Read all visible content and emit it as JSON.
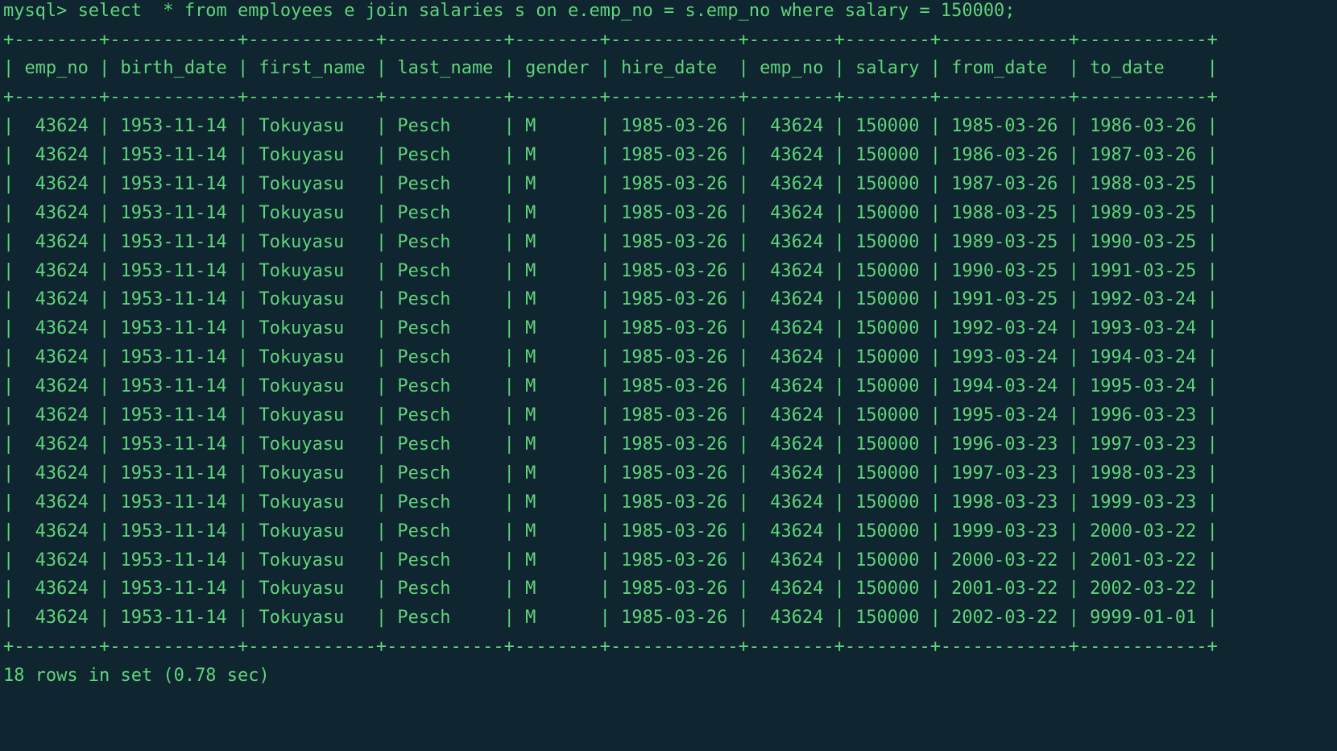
{
  "terminal": {
    "prompt_line": "mysql> select  * from employees e join salaries s on e.emp_no = s.emp_no where salary = 150000;",
    "status_line": "18 rows in set (0.78 sec)"
  },
  "table": {
    "columns": [
      "emp_no",
      "birth_date",
      "first_name",
      "last_name",
      "gender",
      "hire_date",
      "emp_no",
      "salary",
      "from_date",
      "to_date"
    ],
    "rows": [
      [
        "43624",
        "1953-11-14",
        "Tokuyasu",
        "Pesch",
        "M",
        "1985-03-26",
        "43624",
        "150000",
        "1985-03-26",
        "1986-03-26"
      ],
      [
        "43624",
        "1953-11-14",
        "Tokuyasu",
        "Pesch",
        "M",
        "1985-03-26",
        "43624",
        "150000",
        "1986-03-26",
        "1987-03-26"
      ],
      [
        "43624",
        "1953-11-14",
        "Tokuyasu",
        "Pesch",
        "M",
        "1985-03-26",
        "43624",
        "150000",
        "1987-03-26",
        "1988-03-25"
      ],
      [
        "43624",
        "1953-11-14",
        "Tokuyasu",
        "Pesch",
        "M",
        "1985-03-26",
        "43624",
        "150000",
        "1988-03-25",
        "1989-03-25"
      ],
      [
        "43624",
        "1953-11-14",
        "Tokuyasu",
        "Pesch",
        "M",
        "1985-03-26",
        "43624",
        "150000",
        "1989-03-25",
        "1990-03-25"
      ],
      [
        "43624",
        "1953-11-14",
        "Tokuyasu",
        "Pesch",
        "M",
        "1985-03-26",
        "43624",
        "150000",
        "1990-03-25",
        "1991-03-25"
      ],
      [
        "43624",
        "1953-11-14",
        "Tokuyasu",
        "Pesch",
        "M",
        "1985-03-26",
        "43624",
        "150000",
        "1991-03-25",
        "1992-03-24"
      ],
      [
        "43624",
        "1953-11-14",
        "Tokuyasu",
        "Pesch",
        "M",
        "1985-03-26",
        "43624",
        "150000",
        "1992-03-24",
        "1993-03-24"
      ],
      [
        "43624",
        "1953-11-14",
        "Tokuyasu",
        "Pesch",
        "M",
        "1985-03-26",
        "43624",
        "150000",
        "1993-03-24",
        "1994-03-24"
      ],
      [
        "43624",
        "1953-11-14",
        "Tokuyasu",
        "Pesch",
        "M",
        "1985-03-26",
        "43624",
        "150000",
        "1994-03-24",
        "1995-03-24"
      ],
      [
        "43624",
        "1953-11-14",
        "Tokuyasu",
        "Pesch",
        "M",
        "1985-03-26",
        "43624",
        "150000",
        "1995-03-24",
        "1996-03-23"
      ],
      [
        "43624",
        "1953-11-14",
        "Tokuyasu",
        "Pesch",
        "M",
        "1985-03-26",
        "43624",
        "150000",
        "1996-03-23",
        "1997-03-23"
      ],
      [
        "43624",
        "1953-11-14",
        "Tokuyasu",
        "Pesch",
        "M",
        "1985-03-26",
        "43624",
        "150000",
        "1997-03-23",
        "1998-03-23"
      ],
      [
        "43624",
        "1953-11-14",
        "Tokuyasu",
        "Pesch",
        "M",
        "1985-03-26",
        "43624",
        "150000",
        "1998-03-23",
        "1999-03-23"
      ],
      [
        "43624",
        "1953-11-14",
        "Tokuyasu",
        "Pesch",
        "M",
        "1985-03-26",
        "43624",
        "150000",
        "1999-03-23",
        "2000-03-22"
      ],
      [
        "43624",
        "1953-11-14",
        "Tokuyasu",
        "Pesch",
        "M",
        "1985-03-26",
        "43624",
        "150000",
        "2000-03-22",
        "2001-03-22"
      ],
      [
        "43624",
        "1953-11-14",
        "Tokuyasu",
        "Pesch",
        "M",
        "1985-03-26",
        "43624",
        "150000",
        "2001-03-22",
        "2002-03-22"
      ],
      [
        "43624",
        "1953-11-14",
        "Tokuyasu",
        "Pesch",
        "M",
        "1985-03-26",
        "43624",
        "150000",
        "2002-03-22",
        "9999-01-01"
      ]
    ]
  },
  "colors": {
    "background": "#0f2530",
    "text": "#5fd47a"
  }
}
